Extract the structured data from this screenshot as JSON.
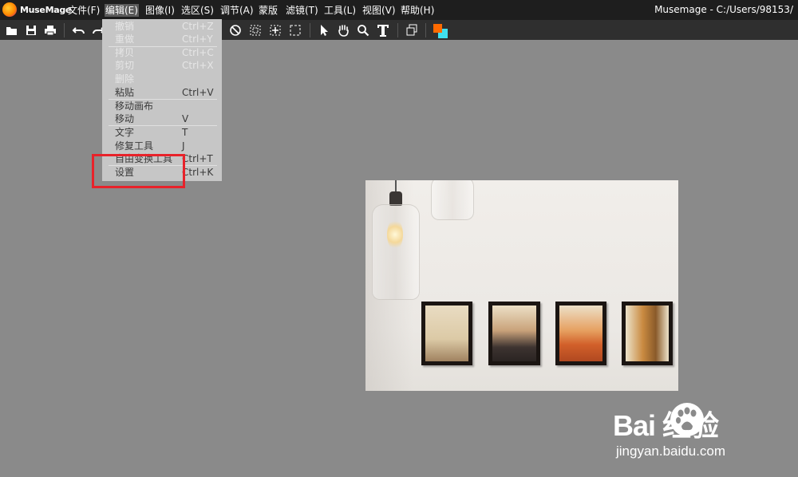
{
  "app": {
    "logo_text": "MuseMage",
    "window_title": "Musemage - C:/Users/98153/"
  },
  "menubar": {
    "items": [
      {
        "label": "文件(F)"
      },
      {
        "label": "编辑(E)",
        "active": true
      },
      {
        "label": "图像(I)"
      },
      {
        "label": "选区(S)"
      },
      {
        "label": "调节(A)"
      },
      {
        "label": "蒙版"
      },
      {
        "label": "滤镜(T)"
      },
      {
        "label": "工具(L)"
      },
      {
        "label": "视图(V)"
      },
      {
        "label": "帮助(H)"
      }
    ]
  },
  "toolbar": {
    "icons": [
      "open-folder-icon",
      "save-icon",
      "print-icon",
      "undo-icon",
      "redo-icon",
      "circle-slash-icon",
      "rect-select-icon",
      "transform-select-icon",
      "dashed-select-icon",
      "pointer-icon",
      "hand-icon",
      "zoom-icon",
      "text-icon",
      "layers-icon",
      "color-swatch-icon"
    ],
    "colors": {
      "foreground": "#ff6a00",
      "background": "#40e0f0"
    }
  },
  "edit_menu": {
    "items": [
      {
        "label": "撤销",
        "shortcut": "Ctrl+Z",
        "enabled": false
      },
      {
        "label": "重做",
        "shortcut": "Ctrl+Y",
        "enabled": false
      },
      {
        "label": "拷贝",
        "shortcut": "Ctrl+C",
        "enabled": false
      },
      {
        "label": "剪切",
        "shortcut": "Ctrl+X",
        "enabled": false
      },
      {
        "label": "删除",
        "shortcut": "",
        "enabled": false
      },
      {
        "label": "粘贴",
        "shortcut": "Ctrl+V",
        "enabled": true
      },
      {
        "label": "移动画布",
        "shortcut": "",
        "enabled": true
      },
      {
        "label": "移动",
        "shortcut": "V",
        "enabled": true
      },
      {
        "label": "文字",
        "shortcut": "T",
        "enabled": true
      },
      {
        "label": "修复工具",
        "shortcut": "J",
        "enabled": true
      },
      {
        "label": "自由变换工具",
        "shortcut": "Ctrl+T",
        "enabled": true
      },
      {
        "label": "设置",
        "shortcut": "Ctrl+K",
        "enabled": true
      }
    ]
  },
  "watermark": {
    "brand": "Bai 经验",
    "url": "jingyan.baidu.com"
  },
  "highlight_color": "#e8222a"
}
